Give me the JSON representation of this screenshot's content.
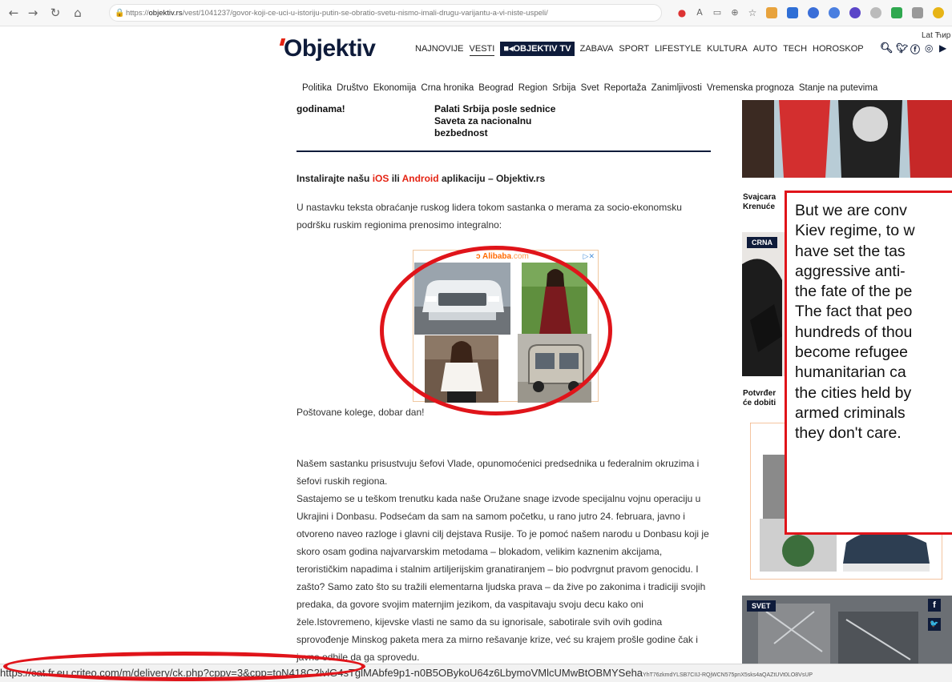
{
  "browser": {
    "url_prefix": "https://",
    "url_host": "objektiv.rs",
    "url_path": "/vest/1041237/govor-koji-ce-uci-u-istoriju-putin-se-obratio-svetu-nismo-imali-drugu-varijantu-a-vi-niste-uspeli/",
    "icons": [
      "back-icon",
      "forward-icon",
      "reload-icon",
      "home-icon",
      "lock-icon"
    ]
  },
  "site": {
    "logo": "Objektiv",
    "lang_switch": "Lat Ћир",
    "top_nav": [
      "NAJNOVIJE",
      "VESTI",
      "OBJEKTIV TV",
      "ZABAVA",
      "SPORT",
      "LIFESTYLE",
      "KULTURA",
      "AUTO",
      "TECH",
      "HOROSKOP"
    ],
    "active_nav": "VESTI",
    "tv_nav": "OBJEKTIV TV",
    "category_nav": [
      "Politika",
      "Društvo",
      "Ekonomija",
      "Crna hronika",
      "Beograd",
      "Region",
      "Srbija",
      "Svet",
      "Reportaža",
      "Zanimljivosti",
      "Vremenska prognoza",
      "Stanje na putevima"
    ],
    "brand_color": "#0e1b3a",
    "accent_color": "#e42313"
  },
  "article": {
    "prev_headline_left": "godinama!",
    "prev_headline_right": [
      "Palati Srbija posle sednice",
      "Saveta za nacionalnu",
      "bezbednost"
    ],
    "install_text_1": "Instalirajte našu ",
    "install_ios": "iOS",
    "install_text_2": " ili ",
    "install_android": "Android",
    "install_text_3": " aplikaciju – Objektiv.rs",
    "intro": "U nastavku teksta obraćanje ruskog lidera tokom sastanka o merama za socio-ekonomsku podršku ruskim regionima prenosimo integralno:",
    "greeting": "Poštovane kolege, dobar dan!",
    "para1": "Našem sastanku prisustvuju šefovi Vlade, opunomoćenici predsednika u federalnim okruzima i šefovi ruskih regiona.",
    "para2": "Sastajemo se u teškom trenutku kada naše Oružane snage izvode specijalnu vojnu operaciju u Ukrajini i Donbasu. Podsećam da sam na samom početku, u rano jutro 24. februara, javno i otvoreno naveo razloge i glavni cilj dejstava Rusije. To je pomoć našem narodu u Donbasu koji je skoro osam godina najvarvarskim metodama – blokadom, velikim kaznenim akcijama, terorističkim napadima i stalnim artiljerijskim granatiranjem – bio podvrgnut pravom genocidu. I zašto? Samo zato što su tražili elementarna ljudska prava – da žive po zakonima i tradiciji svojih predaka, da govore svojim maternjim jezikom, da vaspitavaju svoju decu kako oni žele.Istovremeno, kijevske vlasti ne samo da su ignorisale, sabotirale svih ovih godina sprovođenje Minskog paketa mera za mirno rešavanje krize, već su krajem prošle godine čak i javno odbile da ga sprovedu."
  },
  "ad": {
    "brand": "Alibaba",
    "brand_domain": ".com",
    "choices": "▷✕"
  },
  "sidebar": {
    "caption1": [
      "Švajcara",
      "Krenuće"
    ],
    "tag_crna": "CRNA",
    "caption2": [
      "Potvrđer",
      "će dobiti"
    ],
    "tag_svet": "SVET",
    "social_fb": "f",
    "social_tw": "🐦"
  },
  "quote": {
    "lines": [
      "But we are conv",
      "Kiev regime, to w",
      "have set the tas",
      "aggressive anti-",
      "the fate of the pe",
      "The fact that peo",
      "hundreds of thou",
      "become refugee",
      "humanitarian ca",
      "the cities held by",
      "armed criminals",
      "they don't care."
    ]
  },
  "status_bar": {
    "url": "https://cat.fr.eu.criteo.com/m/delivery/ck.php?cppv=3&cpp=toN418C2lvlG4sTglMAbfe9p1-n0B5OBykoU64z6LbymoVMlcUMwBtOBMYSeha",
    "url_tail": "YhT76zkmdYLSB7CIIJ-RQjWCN575pnX5sks4aQAZtUVt0LO8VsUP"
  }
}
